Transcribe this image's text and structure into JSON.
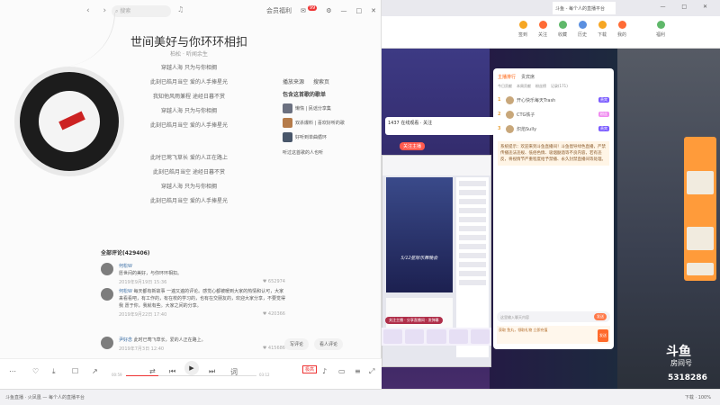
{
  "music": {
    "search_placeholder": "搜索",
    "top_right": [
      "会员福利",
      "邮件",
      "设置"
    ],
    "badge_count": "99",
    "song_title": "世间美好与你环环相扣",
    "song_artist": "柏松 · 听闻余生",
    "lyrics": [
      "穿越人海 只为与你相拥",
      "此刻已皓月当空 爱的人手捧星光",
      "我知他风雨兼程 途经日暮不赏",
      "穿越人海 只为与你相拥",
      "此刻已皓月当空 爱的人手捧星光",
      "",
      "此时已莺飞草长 爱的人正在路上",
      "此刻已皓月当空 途经日暮不赏",
      "穿越人海 只为与你相拥",
      "此刻已皓月当空 爱的人手捧星光"
    ],
    "side": {
      "links": [
        "播放来源",
        "搜索页"
      ],
      "header": "包含这首歌的歌单",
      "playlists": [
        "懒惰 | 民谣分享集",
        "双杀爆料 | 喜欢好听的歌",
        "好听到单曲循环"
      ],
      "like_text": "听过这首歌的人也听"
    },
    "comments_header": "全部评论(429406)",
    "comments": [
      {
        "name": "何松W",
        "text": "愿世间的美好，与你环环相扣。",
        "time": "2019年9月19日 15:36",
        "likes": "652974"
      },
      {
        "name": "何松W",
        "text": "每天都有新故事 一遍又遍的评论。感觉心都被暖到大家的热情和认可，大家来看看吧，有工作的，有在校的学习的，也有在交朋友的，欢迎大家分享，不要觉得我 愿于你，我就有些。大家之间的分享。",
        "time": "2019年9月22日 17:40",
        "likes": "420366"
      },
      {
        "name": "尹好念",
        "text": "此时已莺飞草长，爱的人正在路上。",
        "time": "2019年7月3日 12:40",
        "likes": "415686"
      }
    ],
    "float_buttons": [
      "写评论",
      "看人评论"
    ],
    "time_current": "00:59",
    "time_total": "03:12",
    "quality": "极高"
  },
  "browser": {
    "tab_title": "斗鱼 - 每个人的直播平台",
    "toolbar": [
      "签到",
      "关注",
      "收藏",
      "历史",
      "下载",
      "我的",
      "福利"
    ],
    "stream_card": "1437 在线观看 · 关注",
    "follow_label": "关注主播",
    "inner_video_text": "5/12星际乐舞晚会",
    "notice": "关注主播 · 分享直播间 · 发弹幕",
    "panel": {
      "tabs": [
        "主播排行",
        "贵宾席"
      ],
      "subtabs": [
        "今日贡献",
        "本周贡献",
        "粉丝榜",
        "记录(171)"
      ],
      "ranks": [
        {
          "num": "1",
          "name": "开心快乐每天Trash",
          "level": "贵宾"
        },
        {
          "num": "2",
          "name": "CTG铁子",
          "level": "粉丝"
        },
        {
          "num": "3",
          "name": "炽焰Sully",
          "level": "贵宾"
        }
      ],
      "system_msg": "系统提示：欢迎来到斗鱼直播间！斗鱼倡导绿色直播，严禁传播违法违规、低俗色情、吸烟酗酒等不良内容，若有违反，将视情节严重程度给予禁播、永久封禁直播间等处理。",
      "input_placeholder": "这里输入聊天内容",
      "send_label": "发送",
      "bottom_text": "获取 鱼丸，领取礼物 立即充值"
    },
    "logo": "斗鱼",
    "room_label": "房间号",
    "room_number": "5318286"
  },
  "taskbar": {
    "left": "斗鱼直播 · 火凤凰 — 每个人的直播平台",
    "right": "下载 · 100%"
  }
}
